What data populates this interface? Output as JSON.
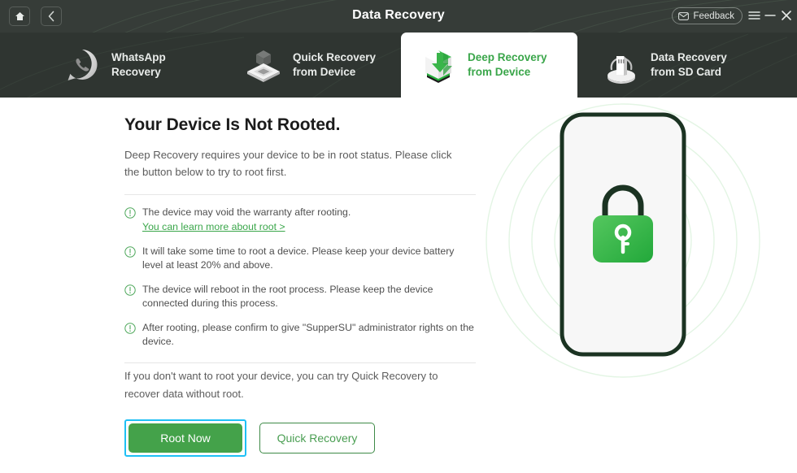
{
  "titlebar": {
    "title": "Data Recovery",
    "home_icon": "home-icon",
    "back_icon": "chevron-left-icon",
    "feedback_label": "Feedback",
    "feedback_icon": "envelope-icon",
    "menu_icon": "hamburger-menu-icon",
    "minimize_icon": "minimize-icon",
    "close_icon": "close-icon"
  },
  "tabs": [
    {
      "id": "whatsapp-recovery",
      "line1": "WhatsApp",
      "line2": "Recovery",
      "icon": "whatsapp-bubble-icon",
      "active": false
    },
    {
      "id": "quick-recovery-device",
      "line1": "Quick Recovery",
      "line2": "from Device",
      "icon": "device-stack-icon",
      "active": false
    },
    {
      "id": "deep-recovery-device",
      "line1": "Deep Recovery",
      "line2": "from Device",
      "icon": "deep-scan-cube-icon",
      "active": true
    },
    {
      "id": "data-recovery-sd-card",
      "line1": "Data Recovery",
      "line2": "from SD Card",
      "icon": "sd-card-icon",
      "active": false
    }
  ],
  "main": {
    "headline": "Your Device Is Not Rooted.",
    "subtext": "Deep Recovery requires your device to be in root status. Please click the button below to try to root first.",
    "notes": [
      {
        "text": "The device may void the warranty after rooting.",
        "link": "You can learn more about root >"
      },
      {
        "text": "It will take some time to root a device. Please keep your device battery level at least 20% and above."
      },
      {
        "text": "The device will reboot in the root process. Please keep the device connected during this process."
      },
      {
        "text": "After rooting, please confirm to give \"SupperSU\" administrator rights on the device."
      }
    ],
    "footnote": "If you don't want to root your device, you can try Quick Recovery to recover data without root.",
    "primary_button": "Root Now",
    "secondary_button": "Quick Recovery",
    "illustration_icon": "phone-with-padlock-illustration"
  },
  "colors": {
    "accent_green": "#3aa64a",
    "button_green": "#44a24a",
    "focus_cyan": "#1ec0f5",
    "titlebar_dark": "#363c38",
    "tabbar_dark": "#2f3531"
  }
}
